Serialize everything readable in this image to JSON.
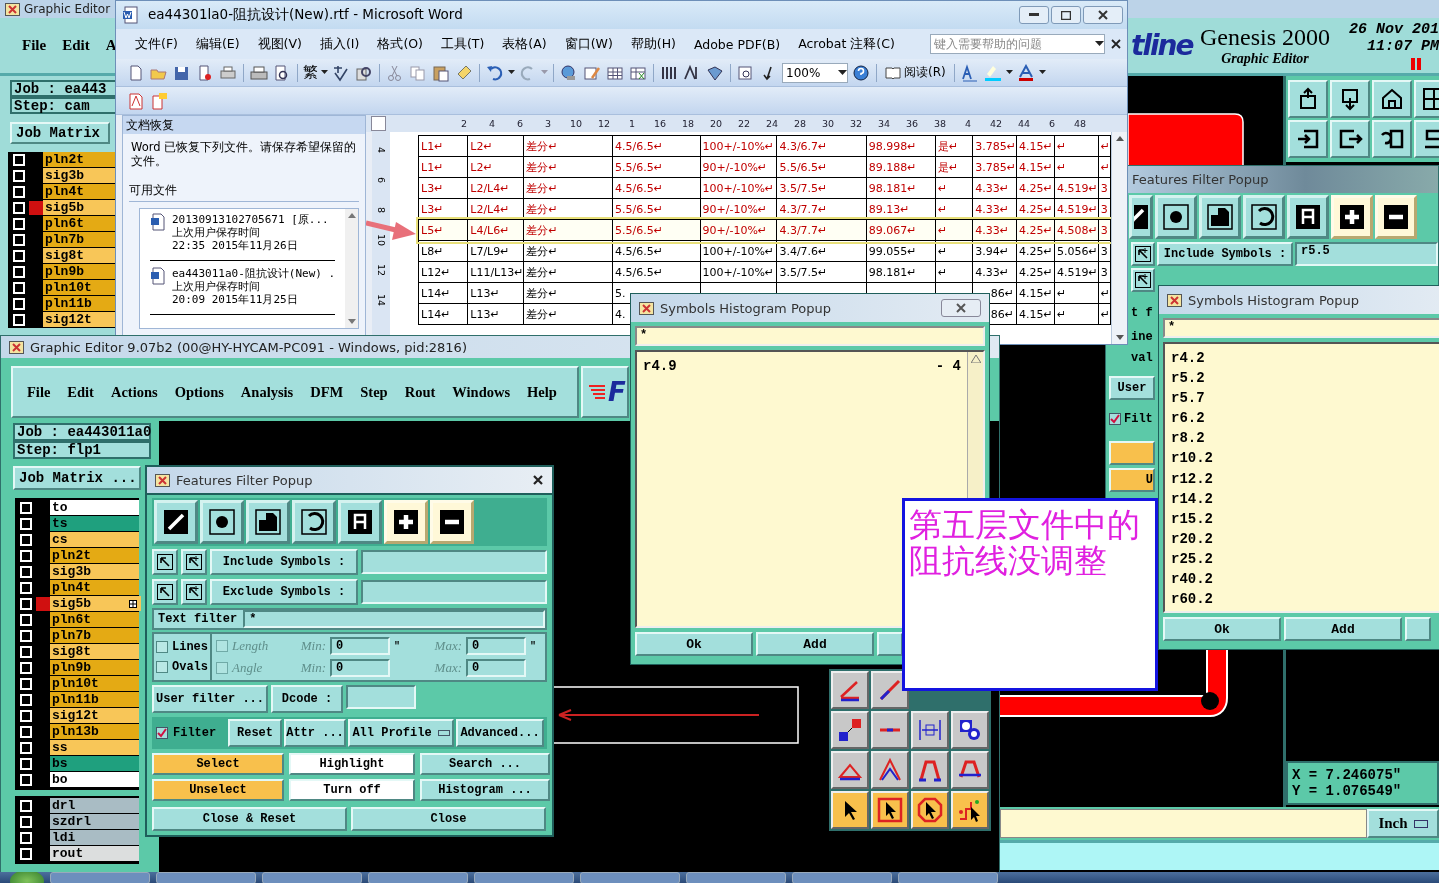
{
  "back_editor": {
    "title": "Graphic Editor",
    "menu": [
      "File",
      "Edit",
      "A"
    ],
    "logo": "tline",
    "product": "Genesis 2000",
    "subtitle": "Graphic Editor",
    "date": "26 Nov 201",
    "time": "11:07 PM",
    "job": "Job : ea443",
    "step": "Step: cam",
    "matrix_button": "Job Matrix",
    "layers": [
      {
        "name": "pln2t",
        "color": "#e4aa14",
        "checked": false,
        "selected": false
      },
      {
        "name": "sig3b",
        "color": "#f8c658",
        "checked": false,
        "selected": false
      },
      {
        "name": "pln4t",
        "color": "#e4aa14",
        "checked": false,
        "selected": false
      },
      {
        "name": "sig5b",
        "color": "#f8c658",
        "checked": false,
        "selected": true
      },
      {
        "name": "pln6t",
        "color": "#e4aa14",
        "checked": false,
        "selected": false
      },
      {
        "name": "pln7b",
        "color": "#e4aa14",
        "checked": false,
        "selected": false
      },
      {
        "name": "sig8t",
        "color": "#f8c658",
        "checked": false,
        "selected": false
      },
      {
        "name": "pln9b",
        "color": "#e4aa14",
        "checked": false,
        "selected": false
      },
      {
        "name": "pln10t",
        "color": "#e4aa14",
        "checked": false,
        "selected": false
      },
      {
        "name": "pln11b",
        "color": "#e4aa14",
        "checked": false,
        "selected": false
      },
      {
        "name": "sig12t",
        "color": "#f8c658",
        "checked": false,
        "selected": false
      }
    ],
    "coordinates": [
      "X = 7.246075\"",
      "Y = 1.076549\""
    ],
    "units": "Inch"
  },
  "back_filter_popup": {
    "title": "Features Filter Popup",
    "tools": [
      {
        "kind": "line",
        "selected": false
      },
      {
        "kind": "pad",
        "selected": false
      },
      {
        "kind": "surface",
        "selected": false
      },
      {
        "kind": "arc",
        "selected": false
      },
      {
        "kind": "text",
        "selected": false
      },
      {
        "kind": "plus",
        "selected": true
      },
      {
        "kind": "minus",
        "selected": true
      }
    ],
    "include_label": "Include Symbols :",
    "include_value": "r5.5",
    "text_filter_fragment": "t f",
    "lines_fragment": "ine",
    "ovals_fragment": "val",
    "user_fragment": "User",
    "filter_fragment": "Filt",
    "filter_checked": true,
    "unselect_fragment": "U"
  },
  "word": {
    "title": "ea44301la0-阻抗设计(New).rtf - Microsoft Word",
    "menu": [
      "文件(F)",
      "编辑(E)",
      "视图(V)",
      "插入(I)",
      "格式(O)",
      "工具(T)",
      "表格(A)",
      "窗口(W)",
      "帮助(H)",
      "Adobe PDF(B)",
      "Acrobat 注释(C)"
    ],
    "help_placeholder": "键入需要帮助的问题",
    "script_button": "繁",
    "zoom": "100%",
    "read_button": "阅读(R)",
    "task_pane": {
      "title": "文档恢复",
      "message": "Word 已恢复下列文件。请保存希望保留的文件。",
      "section": "可用文件",
      "files": [
        {
          "name": "20130913102705671 [原...",
          "caption": "上次用户保存时间",
          "time": "22:35 2015年11月26日"
        },
        {
          "name": "ea443011a0-阻抗设计(New) .",
          "caption": "上次用户保存时间",
          "time": "20:09 2015年11月25日"
        }
      ]
    },
    "ruler": [
      "2",
      "4",
      "6",
      "3",
      "10",
      "12",
      "1",
      "16",
      "18",
      "20",
      "22",
      "24",
      "28",
      "30",
      "32",
      "34",
      "36",
      "38",
      "4",
      "42",
      "44",
      "6",
      "48"
    ],
    "vertical_ruler": [
      "4",
      "6",
      "8",
      "10",
      "12",
      "14"
    ],
    "rows": [
      {
        "color": "#c00000",
        "highlighted": false,
        "cells": [
          "L1↵",
          "L2↵",
          "差分↵",
          "4.5/6.5↵",
          "100+/-10%↵",
          "4.3/6.7↵",
          "98.998↵",
          "是↵",
          "3.785↵",
          "4.15↵",
          "↵",
          "↵"
        ]
      },
      {
        "color": "#c00000",
        "highlighted": false,
        "cells": [
          "L1↵",
          "L2↵",
          "差分↵",
          "5.5/6.5↵",
          "90+/-10%↵",
          "5.5/6.5↵",
          "89.188↵",
          "是↵",
          "3.785↵",
          "4.15↵",
          "↵",
          "↵"
        ]
      },
      {
        "color": "#c00000",
        "highlighted": false,
        "cells": [
          "L3↵",
          "L2/L4↵",
          "差分↵",
          "4.5/6.5↵",
          "100+/-10%↵",
          "3.5/7.5↵",
          "98.181↵",
          "↵",
          "4.33↵",
          "4.25↵",
          "4.519↵",
          "3"
        ]
      },
      {
        "color": "#c00000",
        "highlighted": false,
        "cells": [
          "L3↵",
          "L2/L4↵",
          "差分↵",
          "5.5/6.5↵",
          "90+/-10%↵",
          "4.3/7.7↵",
          "89.13↵",
          "↵",
          "4.33↵",
          "4.25↵",
          "4.519↵",
          "3"
        ]
      },
      {
        "color": "#c00000",
        "highlighted": true,
        "cells": [
          "L5↵",
          "L4/L6↵",
          "差分↵",
          "5.5/6.5↵",
          "90+/-10%↵",
          "4.3/7.7↵",
          "89.067↵",
          "↵",
          "4.33↵",
          "4.25↵",
          "4.508↵",
          "3"
        ]
      },
      {
        "color": "#000000",
        "highlighted": false,
        "cells": [
          "L8↵",
          "L7/L9↵",
          "差分↵",
          "4.5/6.5↵",
          "100+/-10%↵",
          "3.4/7.6↵",
          "99.055↵",
          "↵",
          "3.94↵",
          "4.25↵",
          "5.056↵",
          "3"
        ]
      },
      {
        "color": "#000000",
        "highlighted": false,
        "cells": [
          "L12↵",
          "L11/L13↵",
          "差分↵",
          "4.5/6.5↵",
          "100+/-10%↵",
          "3.5/7.5↵",
          "98.181↵",
          "↵",
          "4.33↵",
          "4.25↵",
          "4.519↵",
          "3"
        ]
      },
      {
        "color": "#000000",
        "highlighted": false,
        "cells": [
          "L14↵",
          "L13↵",
          "差分↵",
          "5.",
          null,
          null,
          null,
          null,
          "86↵",
          "4.15↵",
          "↵",
          "↵"
        ]
      },
      {
        "color": "#000000",
        "highlighted": false,
        "cells": [
          "L14↵",
          "L13↵",
          "差分↵",
          "4.",
          null,
          null,
          null,
          null,
          "86↵",
          "4.15↵",
          "↵",
          "↵"
        ]
      }
    ]
  },
  "editor": {
    "title": "Graphic Editor 9.07b2 (00@HY-HYCAM-PC091 - Windows, pid:2816)",
    "menu": [
      "File",
      "Edit",
      "Actions",
      "Options",
      "Analysis",
      "DFM",
      "Step",
      "Rout",
      "Windows",
      "Help"
    ],
    "logo": "F",
    "job": "Job : ea443011a0",
    "step": "Step: flp1",
    "matrix_button": "Job Matrix ...",
    "layers": [
      {
        "name": "to",
        "color": "#ffffff",
        "checked": false,
        "selected": false
      },
      {
        "name": "ts",
        "color": "#1fa07e",
        "checked": false,
        "selected": false
      },
      {
        "name": "cs",
        "color": "#f8c658",
        "checked": false,
        "selected": false
      },
      {
        "name": "pln2t",
        "color": "#e4aa14",
        "checked": false,
        "selected": false
      },
      {
        "name": "sig3b",
        "color": "#f8c658",
        "checked": false,
        "selected": false
      },
      {
        "name": "pln4t",
        "color": "#e4aa14",
        "checked": false,
        "selected": false
      },
      {
        "name": "sig5b",
        "color": "#f8c658",
        "checked": false,
        "selected": true
      },
      {
        "name": "pln6t",
        "color": "#e4aa14",
        "checked": false,
        "selected": false
      },
      {
        "name": "pln7b",
        "color": "#e4aa14",
        "checked": false,
        "selected": false
      },
      {
        "name": "sig8t",
        "color": "#f8c658",
        "checked": false,
        "selected": false
      },
      {
        "name": "pln9b",
        "color": "#e4aa14",
        "checked": false,
        "selected": false
      },
      {
        "name": "pln10t",
        "color": "#e4aa14",
        "checked": false,
        "selected": false
      },
      {
        "name": "pln11b",
        "color": "#e4aa14",
        "checked": false,
        "selected": false
      },
      {
        "name": "sig12t",
        "color": "#f8c658",
        "checked": false,
        "selected": false
      },
      {
        "name": "pln13b",
        "color": "#e4aa14",
        "checked": false,
        "selected": false
      },
      {
        "name": "ss",
        "color": "#f8c658",
        "checked": false,
        "selected": false
      },
      {
        "name": "bs",
        "color": "#1fa07e",
        "checked": false,
        "selected": false
      },
      {
        "name": "bo",
        "color": "#ffffff",
        "checked": false,
        "selected": false
      }
    ],
    "drill_layers": [
      {
        "name": "drl",
        "color": "#a9bcc4",
        "checked": false,
        "selected": false
      },
      {
        "name": "szdrl",
        "color": "#a9bcc4",
        "checked": false,
        "selected": false
      },
      {
        "name": "ldi",
        "color": "#a9bcc4",
        "checked": false,
        "selected": false
      },
      {
        "name": "rout",
        "color": "#dcdede",
        "checked": false,
        "selected": false
      }
    ]
  },
  "filter_popup": {
    "title": "Features Filter Popup",
    "tools": [
      {
        "kind": "line",
        "selected": false
      },
      {
        "kind": "pad",
        "selected": false
      },
      {
        "kind": "surface",
        "selected": false
      },
      {
        "kind": "arc",
        "selected": false
      },
      {
        "kind": "text",
        "selected": false
      },
      {
        "kind": "plus",
        "selected": true
      },
      {
        "kind": "minus",
        "selected": true
      }
    ],
    "include_label": "Include Symbols :",
    "exclude_label": "Exclude Symbols :",
    "text_filter_label": "Text filter",
    "text_filter_value": "*",
    "shape_rows": [
      {
        "label": "Lines",
        "checked": false,
        "attribute": "Length",
        "disabled": true,
        "min_label": "Min:",
        "min_value": "0",
        "min_unit": "\"",
        "max_label": "Max:",
        "max_value": "0",
        "max_unit": "\""
      },
      {
        "label": "Ovals",
        "checked": false,
        "attribute": "Angle",
        "disabled": true,
        "min_label": "Min:",
        "min_value": "0",
        "max_label": "Max:",
        "max_value": "0"
      }
    ],
    "user_filter_button": "User filter ...",
    "dcode_label": "Dcode :",
    "filter_label": "Filter",
    "filter_checked": true,
    "option_buttons": [
      "Reset",
      "Attr ...",
      "All Profile",
      "Advanced..."
    ],
    "actions": [
      {
        "label": "Select",
        "color": "#f8c04c"
      },
      {
        "label": "Highlight",
        "color": "#ffffff"
      },
      {
        "label": "Search ...",
        "color": "#a3dfdc"
      },
      {
        "label": "Unselect",
        "color": "#f8c04c"
      },
      {
        "label": "Turn off",
        "color": "#ffffff"
      },
      {
        "label": "Histogram ...",
        "color": "#a3dfdc"
      }
    ],
    "footer_buttons": [
      "Close & Reset",
      "Close"
    ]
  },
  "histogram_popup": {
    "title": "Symbols Histogram Popup",
    "filter": "*",
    "items": [
      {
        "symbol": "r4.9",
        "count": "- 4"
      }
    ],
    "buttons": [
      "Ok",
      "Add"
    ]
  },
  "histogram_popup_right": {
    "title": "Symbols Histogram Popup",
    "filter": "*",
    "items": [
      {
        "symbol": "r4.2"
      },
      {
        "symbol": "r5.2"
      },
      {
        "symbol": "r5.7"
      },
      {
        "symbol": "r6.2"
      },
      {
        "symbol": "r8.2"
      },
      {
        "symbol": "r10.2"
      },
      {
        "symbol": "r12.2"
      },
      {
        "symbol": "r14.2"
      },
      {
        "symbol": "r15.2"
      },
      {
        "symbol": "r20.2"
      },
      {
        "symbol": "r25.2"
      },
      {
        "symbol": "r40.2"
      },
      {
        "symbol": "r60.2"
      }
    ],
    "buttons": [
      "Ok",
      "Add"
    ]
  },
  "note": {
    "text": "第五层文件中的阻抗线没调整"
  }
}
